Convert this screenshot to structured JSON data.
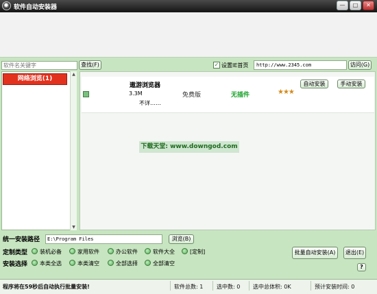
{
  "window": {
    "title": "软件自动安装器",
    "minimize": "—",
    "maximize": "□",
    "close": "✕"
  },
  "search": {
    "placeholder": "软件名关键字",
    "button_label": "查找(F)"
  },
  "homepage": {
    "checkbox_mark": "✓",
    "label": "设置IE首页",
    "url_value": "http://www.2345.com",
    "visit_label": "访问(G)"
  },
  "categories": {
    "active": "网络浏览(1)"
  },
  "software": {
    "items": [
      {
        "name": "遨游浏览器",
        "size": "3.3M",
        "price": "免费版",
        "plugin": "无插件",
        "rating": "★★★",
        "description": "不详……",
        "auto_install_label": "自动安装",
        "manual_install_label": "手动安装"
      }
    ]
  },
  "watermark": "下载天堂: www.downgod.com",
  "install": {
    "path_label": "统一安装路径",
    "path_value": "E:\\Program Files",
    "browse_label": "浏览(B)",
    "customize_label": "定制类型",
    "customize_options": [
      "装机必备",
      "家用软件",
      "办公软件",
      "软件大全",
      "[定制]"
    ],
    "select_label": "安装选择",
    "select_options": [
      "本类全选",
      "本类清空",
      "全部选择",
      "全部清空"
    ],
    "batch_label": "批量自动安装(A)",
    "exit_label": "退出(E)",
    "help_label": "?"
  },
  "status": {
    "message": "程序将在59秒后自动执行批量安装!",
    "total": "软件总数: 1",
    "selected": "选中数: 0",
    "selected_size": "选中总体积: 0K",
    "estimated_time": "预计安装时间: 0"
  }
}
